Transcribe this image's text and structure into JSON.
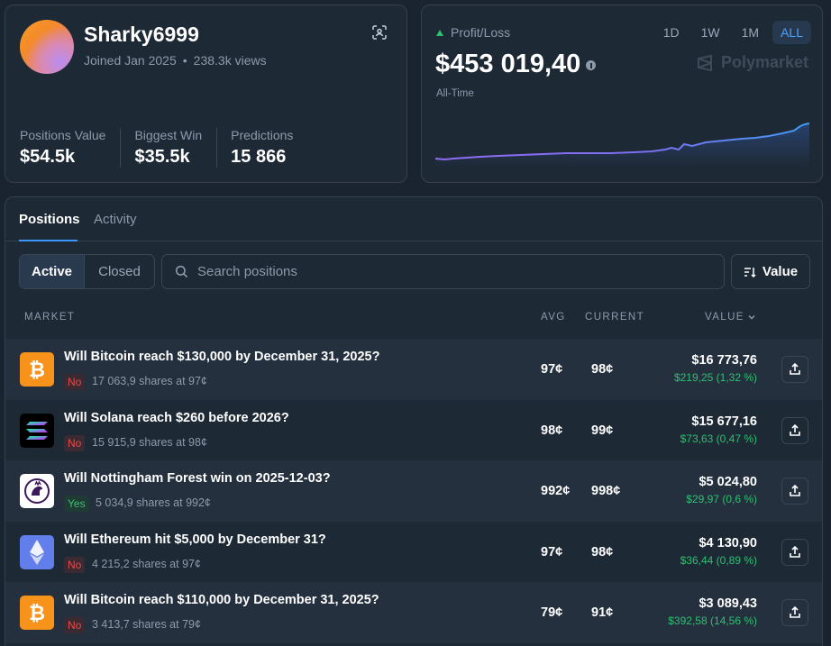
{
  "profile": {
    "username": "Sharky6999",
    "joined": "Joined Jan 2025",
    "views": "238.3k views",
    "dot": "•",
    "stats": [
      {
        "label": "Positions Value",
        "value": "$54.5k"
      },
      {
        "label": "Biggest Win",
        "value": "$35.5k"
      },
      {
        "label": "Predictions",
        "value": "15 866"
      }
    ]
  },
  "pnl": {
    "label": "Profit/Loss",
    "value": "$453 019,40",
    "period": "All-Time",
    "ranges": [
      "1D",
      "1W",
      "1M",
      "ALL"
    ],
    "active_range": "ALL",
    "brand": "Polymarket",
    "colors": {
      "up": "#2fbf71",
      "line_start": "#8f6cf2",
      "line_end": "#3f9bf2"
    }
  },
  "tabs": [
    "Positions",
    "Activity"
  ],
  "filters": {
    "active": "Active",
    "closed": "Closed"
  },
  "search": {
    "placeholder": "Search positions"
  },
  "sort": {
    "label": "Value"
  },
  "columns": {
    "market": "MARKET",
    "avg": "AVG",
    "current": "CURRENT",
    "value": "VALUE"
  },
  "rows": [
    {
      "icon": "bitcoin-icon",
      "title": "Will Bitcoin reach $130,000 by December 31, 2025?",
      "outcome": "No",
      "shares": "17 063,9 shares at 97¢",
      "avg": "97¢",
      "current": "98¢",
      "value": "$16 773,76",
      "change": "$219,25 (1,32 %)"
    },
    {
      "icon": "solana-icon",
      "title": "Will Solana reach $260 before 2026?",
      "outcome": "No",
      "shares": "15 915,9 shares at 98¢",
      "avg": "98¢",
      "current": "99¢",
      "value": "$15 677,16",
      "change": "$73,63 (0,47 %)"
    },
    {
      "icon": "premier-league-icon",
      "title": "Will Nottingham Forest win on 2025-12-03?",
      "outcome": "Yes",
      "shares": "5 034,9 shares at 992¢",
      "avg": "992¢",
      "current": "998¢",
      "value": "$5 024,80",
      "change": "$29,97 (0,6 %)"
    },
    {
      "icon": "ethereum-icon",
      "title": "Will Ethereum hit $5,000 by December 31?",
      "outcome": "No",
      "shares": "4 215,2 shares at 97¢",
      "avg": "97¢",
      "current": "98¢",
      "value": "$4 130,90",
      "change": "$36,44 (0,89 %)"
    },
    {
      "icon": "bitcoin-icon",
      "title": "Will Bitcoin reach $110,000 by December 31, 2025?",
      "outcome": "No",
      "shares": "3 413,7 shares at 79¢",
      "avg": "79¢",
      "current": "91¢",
      "value": "$3 089,43",
      "change": "$392,58 (14,56 %)"
    }
  ]
}
